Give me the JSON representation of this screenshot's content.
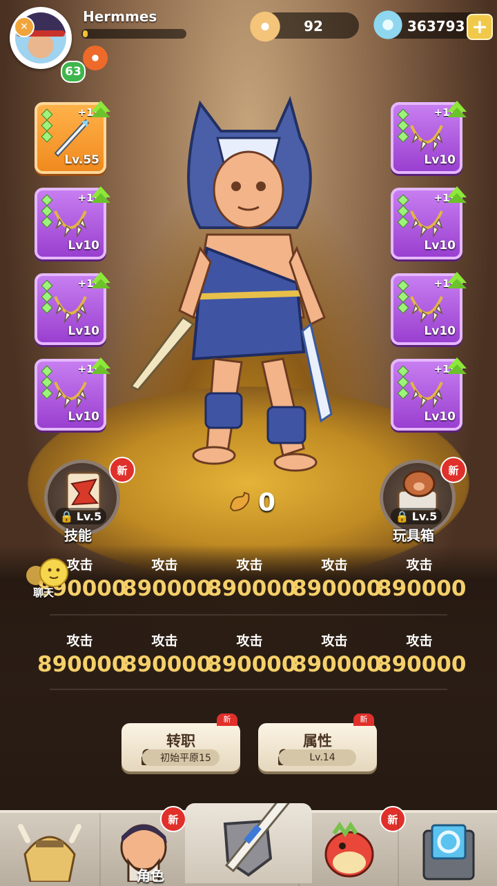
{
  "player": {
    "name": "Hermmes",
    "level": "63",
    "exp_fraction": 0.05
  },
  "resources": {
    "shells": "92",
    "gems": "363793"
  },
  "equipment": {
    "left": [
      {
        "plus": "+19",
        "level": "Lv.55",
        "rarity": "orange"
      },
      {
        "plus": "+19",
        "level": "Lv10",
        "rarity": "purple"
      },
      {
        "plus": "+19",
        "level": "Lv10",
        "rarity": "purple"
      },
      {
        "plus": "+19",
        "level": "Lv10",
        "rarity": "purple"
      }
    ],
    "right": [
      {
        "plus": "+19",
        "level": "Lv10",
        "rarity": "purple"
      },
      {
        "plus": "+19",
        "level": "Lv10",
        "rarity": "purple"
      },
      {
        "plus": "+19",
        "level": "Lv10",
        "rarity": "purple"
      },
      {
        "plus": "+19",
        "level": "Lv10",
        "rarity": "purple"
      }
    ]
  },
  "skill_button": {
    "label": "技能",
    "level": "Lv.5",
    "badge": "新"
  },
  "toybox_button": {
    "label": "玩具箱",
    "level": "Lv.5",
    "badge": "新"
  },
  "power": {
    "value": "0"
  },
  "chat": {
    "label": "聊天"
  },
  "stats": {
    "row1": [
      {
        "label": "攻击",
        "value": "890000"
      },
      {
        "label": "攻击",
        "value": "890000"
      },
      {
        "label": "攻击",
        "value": "890000"
      },
      {
        "label": "攻击",
        "value": "890000"
      },
      {
        "label": "攻击",
        "value": "890000"
      }
    ],
    "row2": [
      {
        "label": "攻击",
        "value": "890000"
      },
      {
        "label": "攻击",
        "value": "890000"
      },
      {
        "label": "攻击",
        "value": "890000"
      },
      {
        "label": "攻击",
        "value": "890000"
      },
      {
        "label": "攻击",
        "value": "890000"
      }
    ]
  },
  "actions": {
    "job_change": {
      "title": "转职",
      "sub": "初始平原15",
      "badge": "新"
    },
    "attributes": {
      "title": "属性",
      "sub": "Lv.14",
      "badge": "新"
    }
  },
  "nav": {
    "tabs": [
      {
        "icon": "tribe-icon",
        "label": ""
      },
      {
        "icon": "character-icon",
        "label": "角色",
        "badge": "新"
      },
      {
        "icon": "sword-shield-icon",
        "label": ""
      },
      {
        "icon": "pet-dino-icon",
        "label": "",
        "badge": "新"
      },
      {
        "icon": "portal-icon",
        "label": ""
      }
    ]
  },
  "colors": {
    "accent_gold": "#f5d06a",
    "purple_slot": "#9a3fd0",
    "orange_slot": "#f08a1e",
    "new_badge": "#e0302b"
  }
}
